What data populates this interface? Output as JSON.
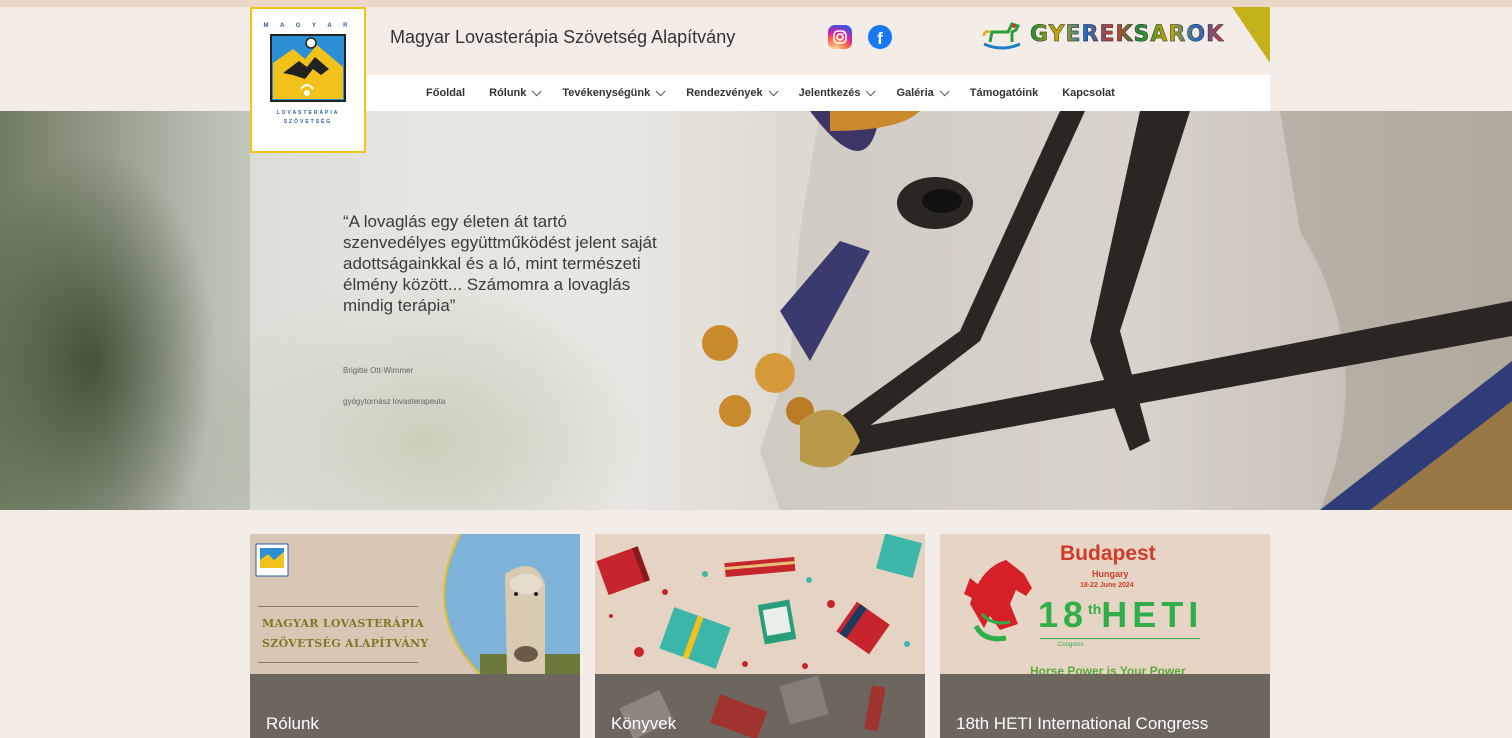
{
  "header": {
    "logo_top_text": "M A G Y A R",
    "logo_bottom_line1": "LOVASTERÁPIA",
    "logo_bottom_line2": "SZÖVETSÉG",
    "site_title": "Magyar Lovasterápia Szövetség Alapítvány",
    "kids_corner": "GYEREKSAROK"
  },
  "nav": {
    "items": [
      {
        "label": "Főoldal",
        "dropdown": false
      },
      {
        "label": "Rólunk",
        "dropdown": true
      },
      {
        "label": "Tevékenységünk",
        "dropdown": true
      },
      {
        "label": "Rendezvények",
        "dropdown": true
      },
      {
        "label": "Jelentkezés",
        "dropdown": true
      },
      {
        "label": "Galéria",
        "dropdown": true
      },
      {
        "label": "Támogatóink",
        "dropdown": false
      },
      {
        "label": "Kapcsolat",
        "dropdown": false
      }
    ]
  },
  "hero": {
    "quote": "“A lovaglás egy életen át tartó szenvedélyes együttműködést jelent saját adottságainkkal és a ló, mint természeti élmény között... Számomra a lovaglás mindig terápia”",
    "author": "Brigitte Ott-Wimmer",
    "author_role": "gyógytornász lovasterapeuta"
  },
  "cards": [
    {
      "label": "Rólunk",
      "graphic_text_line1": "MAGYAR LOVASTERÁPIA",
      "graphic_text_line2": "SZÖVETSÉG ALAPÍTVÁNY"
    },
    {
      "label": "Könyvek"
    },
    {
      "label": "18th HETI International Congress",
      "city": "Budapest",
      "country": "Hungary",
      "dates": "18-22 June 2024",
      "event": "18",
      "event_sup": "th",
      "event_name": "HETI",
      "small": "Congress",
      "slogan": "Horse Power is Your Power"
    }
  ],
  "colors": {
    "page_bg": "#f4ede7",
    "card_bar": "#6d665f",
    "logo_border": "#f0c419",
    "heti_green": "#2fae4a",
    "heti_red": "#d13b2a"
  },
  "icons": [
    "instagram-icon",
    "facebook-icon",
    "rocking-horse-icon",
    "chevron-down-icon"
  ]
}
